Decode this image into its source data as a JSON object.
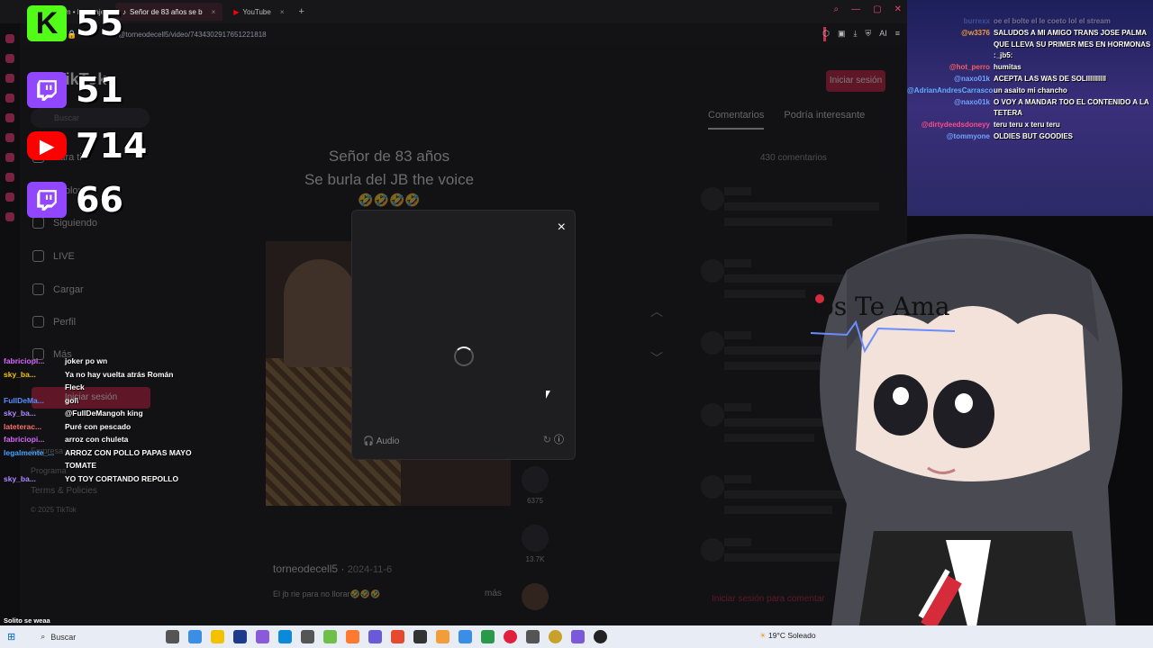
{
  "browser": {
    "tabs": [
      {
        "label": "Instagram • Mensaje",
        "active": false
      },
      {
        "label": "Señor de 83 años se b",
        "active": true
      },
      {
        "label": "YouTube",
        "active": false
      }
    ],
    "url": "om/@torneodecell5/video/743430291765122181​8"
  },
  "tiktok": {
    "logo": "TikTok",
    "search_placeholder": "Buscar",
    "nav": [
      {
        "label": "Para ti",
        "icon": "home-icon"
      },
      {
        "label": "Explorar",
        "icon": "compass-icon"
      },
      {
        "label": "Siguiendo",
        "icon": "following-icon"
      },
      {
        "label": "LIVE",
        "icon": "live-icon"
      },
      {
        "label": "Cargar",
        "icon": "plus-icon"
      },
      {
        "label": "Perfil",
        "icon": "person-icon"
      },
      {
        "label": "Más",
        "icon": "more-icon"
      }
    ],
    "login_side": "Iniciar sesión",
    "footer": [
      "Empresa",
      "Programa",
      "Terms & Policies",
      "© 2025 TikTok"
    ],
    "video_title_line1": "Señor de 83 años",
    "video_title_line2": "Se burla del JB the voice",
    "video_title_emoji": "🤣🤣🤣🤣",
    "author": "torneodecell5",
    "date": "2024-11-6",
    "caption": "El jb rie para no llorar🤣🤣🤣",
    "more": "más",
    "count_saves": "6375",
    "count_shares": "13.7K",
    "login_top": "Iniciar sesión",
    "tab_comments": "Comentarios",
    "tab_interesting": "Podría interesante",
    "comments_count": "430 comentarios",
    "comment_cta": "Iniciar sesión para comentar"
  },
  "modal": {
    "close": "×",
    "audio": "Audio",
    "info": "ⓘ"
  },
  "counters": [
    {
      "platform": "kick-icon",
      "badge": "K",
      "value": "55",
      "color": "#53fc18"
    },
    {
      "platform": "twitch-icon",
      "badge": "",
      "value": "51",
      "color": "#9146ff"
    },
    {
      "platform": "youtube-icon",
      "badge": "▶",
      "value": "714",
      "color": "#ff0000"
    },
    {
      "platform": "twitch-icon",
      "badge": "",
      "value": "66",
      "color": "#9146ff"
    }
  ],
  "left_chat": [
    {
      "user": "fabriciopi...",
      "msg": "joker po wn",
      "color": "#d866ff"
    },
    {
      "user": "sky_ba...",
      "msg": "Ya no hay vuelta atrás Román Fleck",
      "color": "#f2c200"
    },
    {
      "user": "FullDeMa...",
      "msg": "gol\\",
      "color": "#5a8cff"
    },
    {
      "user": "sky_ba...",
      "msg": "@FullDeMangoh king",
      "color": "#b088ff"
    },
    {
      "user": "lateterac...",
      "msg": "Puré con pescado",
      "color": "#ff6f6f"
    },
    {
      "user": "fabriciopi...",
      "msg": "arroz con chuleta",
      "color": "#d866ff"
    },
    {
      "user": "legalmente_...",
      "msg": "ARROZ CON POLLO PAPAS MAYO TOMATE",
      "color": "#45a1ff"
    },
    {
      "user": "sky_ba...",
      "msg": "YO TOY CORTANDO REPOLLO",
      "color": "#b088ff"
    }
  ],
  "left_bottom_msg": "Solito se weaa",
  "right_chat": [
    {
      "user": "burrexx",
      "msg": "oe el bolte el le coeto lol el stream",
      "dim": true
    },
    {
      "user": "@w3376",
      "msg": "SALUDOS A MI AMIGO TRANS JOSE PALMA QUE LLEVA SU PRIMER MES EN HORMONAS :_jb5:"
    },
    {
      "user": "@hot_perro",
      "msg": "humitas"
    },
    {
      "user": "@naxo01k",
      "msg": "ACEPTA LAS WAS DE SOLIIIIIIIIII"
    },
    {
      "user": "@AdrianAndresCarrasco...",
      "msg": "un asaito mi chancho"
    },
    {
      "user": "@naxo01k",
      "msg": "O VOY A MANDAR TOO EL CONTENIDO A LA TETERA"
    },
    {
      "user": "@dirtydeedsdoneyy",
      "msg": "teru teru x teru teru"
    },
    {
      "user": "@tommyone",
      "msg": "OLDIES BUT GOODIES"
    }
  ],
  "avatar": {
    "headband_text": "ios Te Ama"
  },
  "taskbar": {
    "search": "Buscar",
    "weather": "19°C  Soleado"
  }
}
